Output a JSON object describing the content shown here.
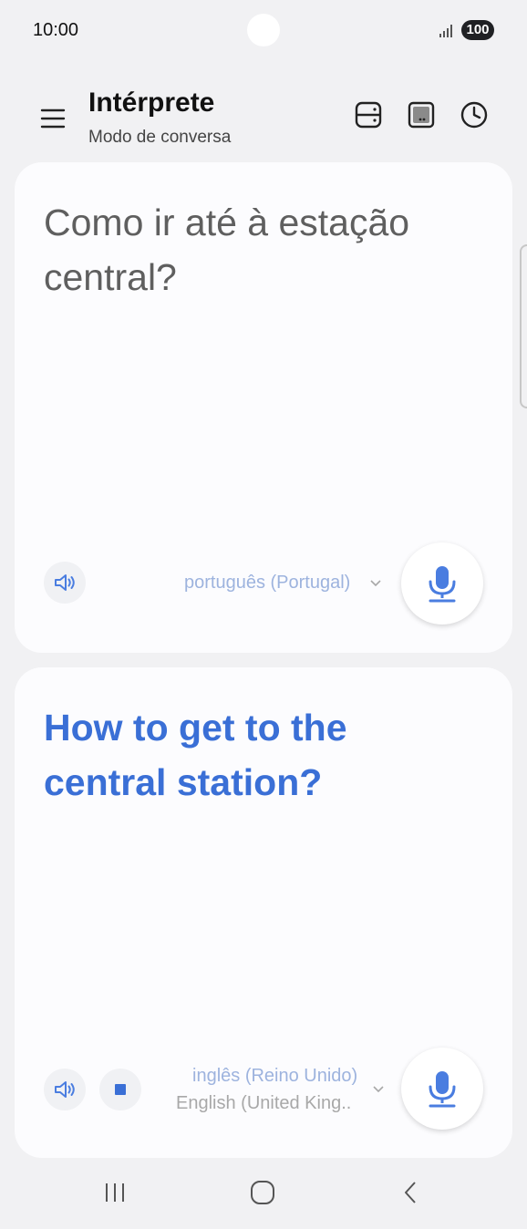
{
  "status": {
    "time": "10:00",
    "battery": "100"
  },
  "app": {
    "title": "Intérprete",
    "subtitle": "Modo de conversa"
  },
  "source": {
    "text": "Como ir até à estação central?",
    "language": "português (Portugal)"
  },
  "target": {
    "text": "How to get to the central station?",
    "language": "inglês (Reino Unido)",
    "language_native": "English (United King.."
  },
  "icons": {
    "menu": "menu-icon",
    "layout": "split-screen-icon",
    "cover_screen": "cover-screen-icon",
    "history": "history-icon",
    "speaker": "speaker-icon",
    "stop": "stop-icon",
    "mic": "microphone-icon",
    "chevron": "chevron-down-icon"
  },
  "colors": {
    "accent": "#3a6fd6",
    "mic": "#4a7de0",
    "language_muted": "#9db3de"
  }
}
